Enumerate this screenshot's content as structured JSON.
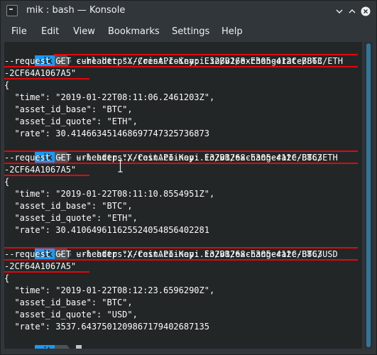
{
  "window": {
    "title": "mik : bash — Konsole"
  },
  "menu": {
    "items": [
      "File",
      "Edit",
      "View",
      "Bookmarks",
      "Settings",
      "Help"
    ]
  },
  "prompt": {
    "user": "mik",
    "dir": "~"
  },
  "terminal": {
    "lines": [
      "curl https://rest.coinapi.io/v1/exchangerate/BTC/ETH",
      "--request GET --header \"X-CoinAPI-Key: E32BB268-E305-412C-B863",
      "-2CF64A1067A5\"",
      "{",
      "  \"time\": \"2019-01-22T08:11:06.2461203Z\",",
      "  \"asset_id_base\": \"BTC\",",
      "  \"asset_id_quote\": \"ETH\",",
      "  \"rate\": 30.414663451468697747325736873",
      "url https://rest.coinapi.io/v1/exchangerate/BTC/ETH",
      "--request GET --header \"X-CoinAPI-Key: E32BB268-E305-412C-B863",
      "-2CF64A1067A5\"",
      "{",
      "  \"time\": \"2019-01-22T08:11:10.8554951Z\",",
      "  \"asset_id_base\": \"BTC\",",
      "  \"asset_id_quote\": \"ETH\",",
      "  \"rate\": 30.410649611625524054856402281",
      "url https://rest.coinapi.io/v1/exchangerate/BTC/USD",
      "--request GET --header \"X-CoinAPI-Key: E32BB268-E305-412C-B863",
      "-2CF64A1067A5\"",
      "{",
      "  \"time\": \"2019-01-22T08:12:23.6596290Z\",",
      "  \"asset_id_base\": \"BTC\",",
      "  \"asset_id_quote\": \"USD\",",
      "  \"rate\": 3537.6437501209867179402687135"
    ]
  },
  "colors": {
    "prompt_user_bg": "#1d99f3",
    "annotation_red": "#e3070d",
    "terminal_bg": "#232627"
  },
  "icons": [
    "konsole-app-icon",
    "minimize-icon",
    "maximize-icon",
    "close-icon"
  ]
}
